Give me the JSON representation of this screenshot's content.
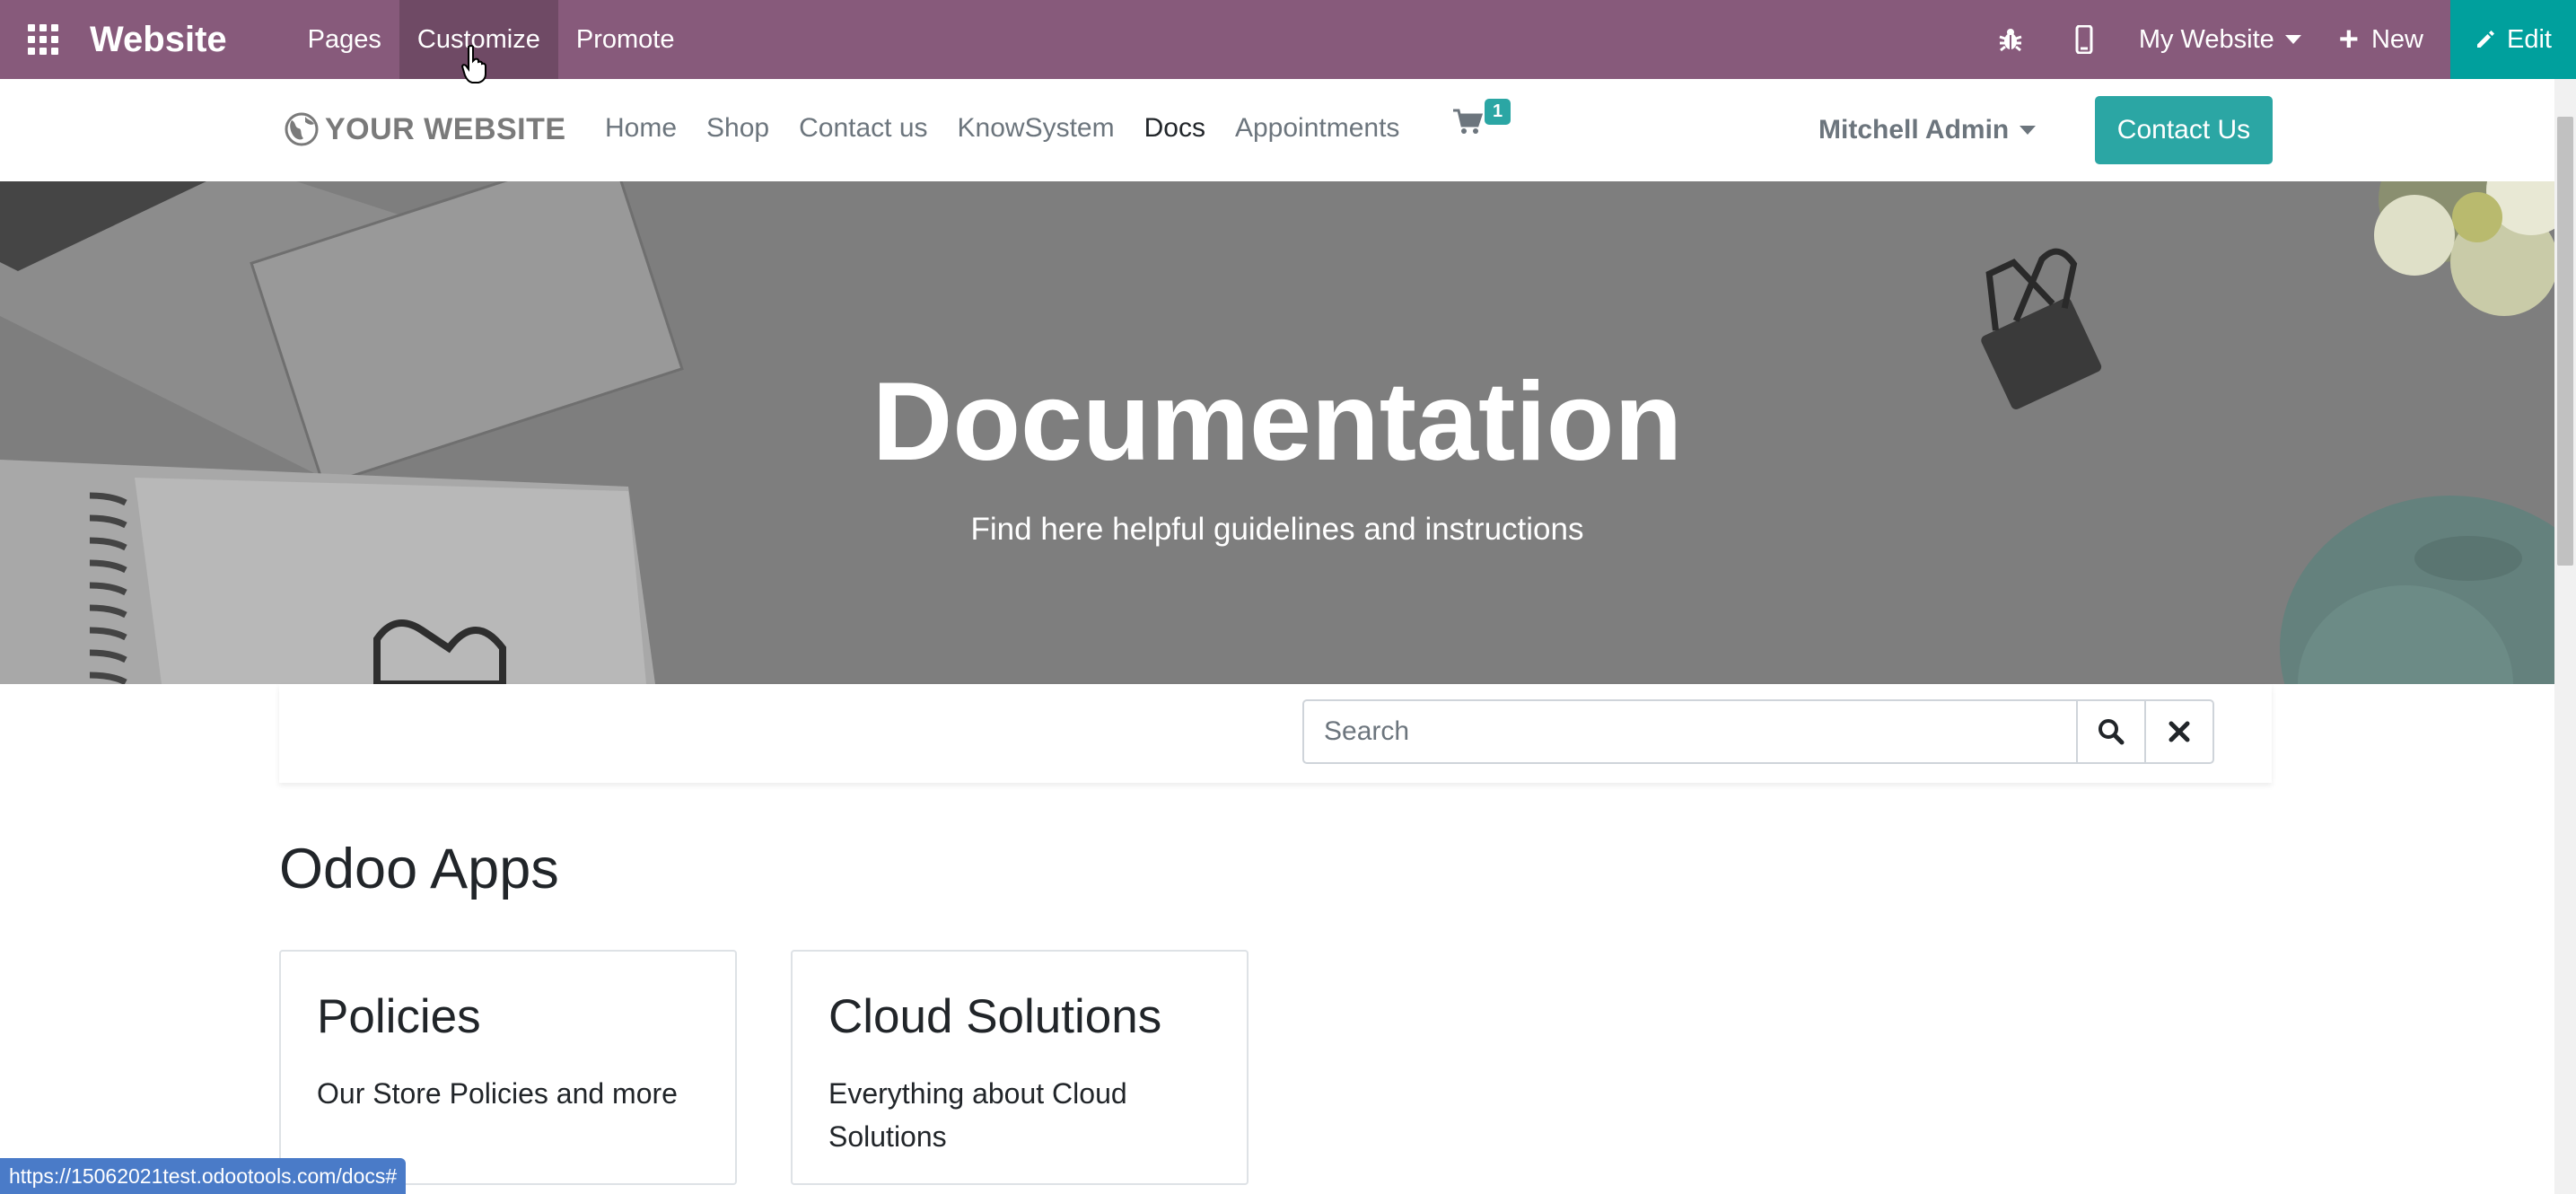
{
  "admin_bar": {
    "app_title": "Website",
    "menus": [
      "Pages",
      "Customize",
      "Promote"
    ],
    "active_menu": "Customize",
    "website_selector": "My Website",
    "new_label": "New",
    "edit_label": "Edit",
    "accent_color": "#875a7b",
    "edit_color": "#00a09d",
    "icons": [
      "apps-grid-icon",
      "bug-icon",
      "mobile-icon",
      "plus-icon",
      "pencil-icon"
    ]
  },
  "site_header": {
    "logo_text": "YOUR WEBSITE",
    "nav": [
      "Home",
      "Shop",
      "Contact us",
      "KnowSystem",
      "Docs",
      "Appointments"
    ],
    "active_nav": "Docs",
    "cart_count": "1",
    "user_name": "Mitchell Admin",
    "contact_button": "Contact Us",
    "button_color": "#2ba6a4"
  },
  "hero": {
    "title": "Documentation",
    "subtitle": "Find here helpful guidelines and instructions"
  },
  "search": {
    "placeholder": "Search",
    "value": ""
  },
  "section": {
    "title": "Odoo Apps",
    "cards": [
      {
        "title": "Policies",
        "description": "Our Store Policies and more"
      },
      {
        "title": "Cloud Solutions",
        "description": "Everything about Cloud Solutions"
      }
    ]
  },
  "status_url": "https://15062021test.odootools.com/docs#"
}
